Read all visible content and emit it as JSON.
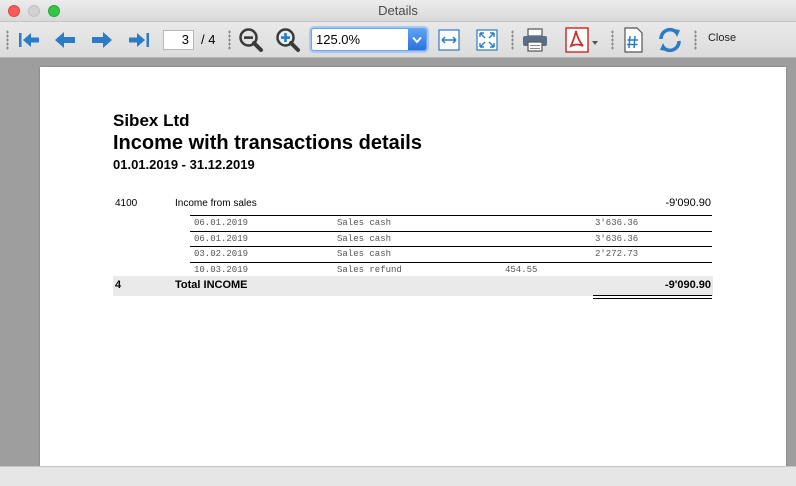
{
  "window": {
    "title": "Details"
  },
  "toolbar": {
    "first_page": "first-page",
    "prev_page": "previous-page",
    "next_page": "next-page",
    "last_page": "last-page",
    "current_page": "3",
    "total_pages": "/ 4",
    "zoom_value": "125.0%",
    "close_label": "Close"
  },
  "report": {
    "company": "Sibex Ltd",
    "title": "Income with transactions details",
    "period": "01.01.2019 - 31.12.2019",
    "account": {
      "number": "4100",
      "name": "Income from sales",
      "amount": "-9'090.90"
    },
    "transactions": [
      {
        "date": "06.01.2019",
        "description": "Sales cash",
        "debit": "",
        "credit": "3'636.36"
      },
      {
        "date": "06.01.2019",
        "description": "Sales cash",
        "debit": "",
        "credit": "3'636.36"
      },
      {
        "date": "03.02.2019",
        "description": "Sales cash",
        "debit": "",
        "credit": "2'272.73"
      },
      {
        "date": "10.03.2019",
        "description": "Sales refund",
        "debit": "454.55",
        "credit": ""
      }
    ],
    "total": {
      "number": "4",
      "label": "Total INCOME",
      "amount": "-9'090.90"
    }
  },
  "colors": {
    "toolbar_icon_blue": "#2b7bc6",
    "pdf_red": "#d0302c",
    "zoom_focus": "#6fa3e8"
  }
}
